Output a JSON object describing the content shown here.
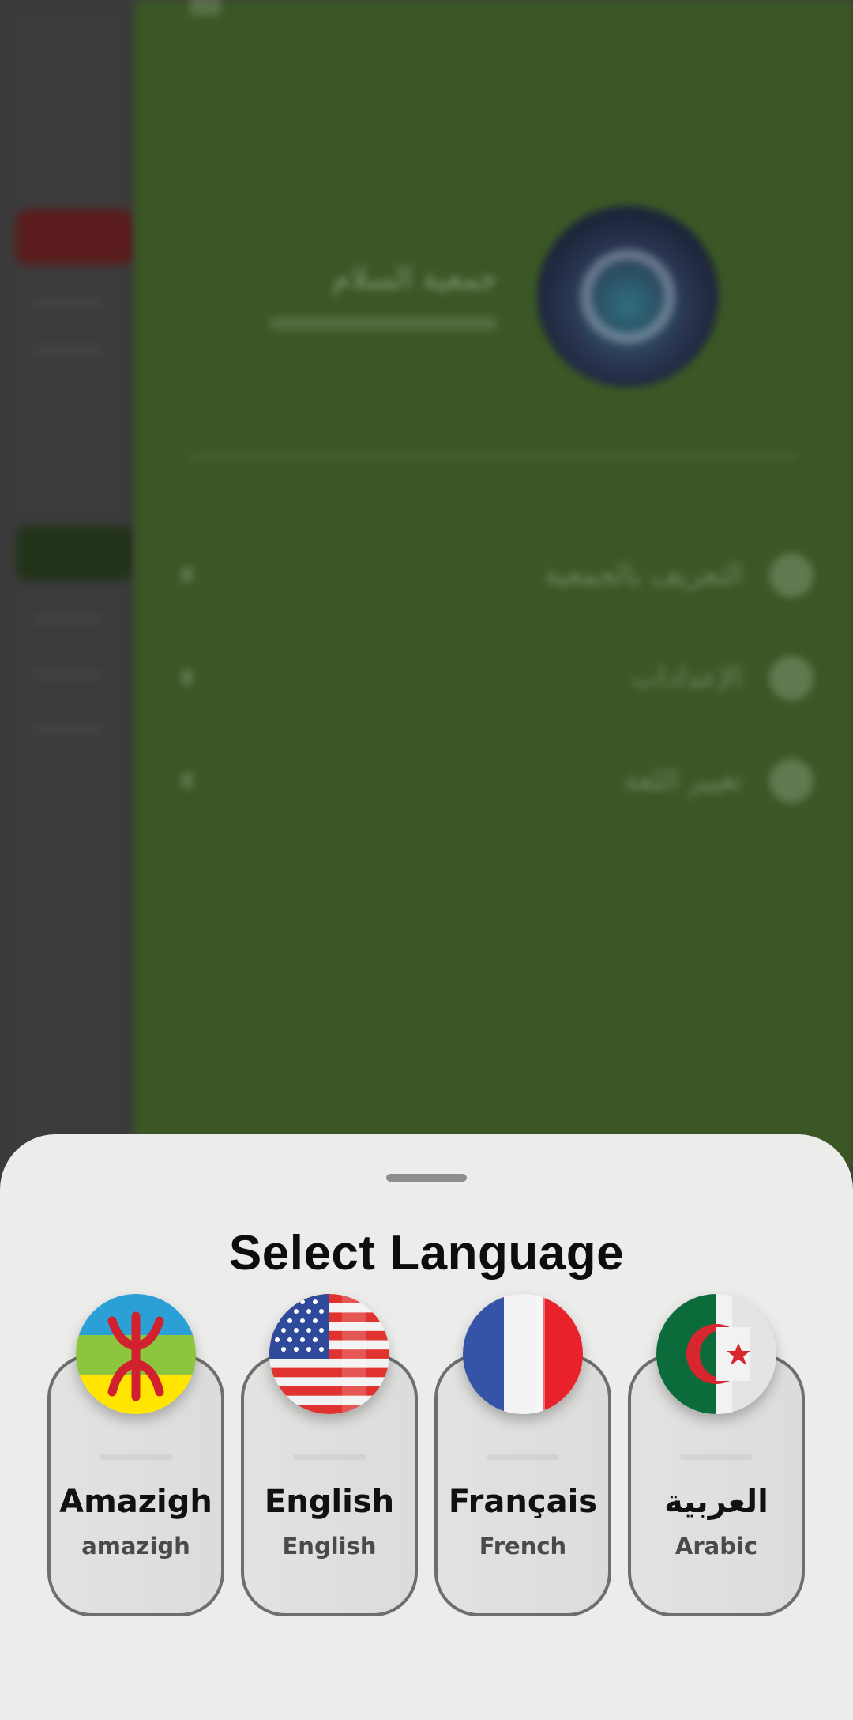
{
  "background_app": {
    "profile_name": "جمعية السلام",
    "menu_items": [
      {
        "label": "التعريف بالجمعية",
        "icon": "info-icon"
      },
      {
        "label": "الإعدادات",
        "icon": "settings-icon"
      },
      {
        "label": "تغيير اللغة",
        "icon": "language-icon"
      }
    ]
  },
  "sheet": {
    "title": "Select Language",
    "languages": [
      {
        "name": "Amazigh",
        "subtitle": "amazigh",
        "flag": "amazigh-flag-icon"
      },
      {
        "name": "English",
        "subtitle": "English",
        "flag": "us-flag-icon"
      },
      {
        "name": "Français",
        "subtitle": "French",
        "flag": "france-flag-icon"
      },
      {
        "name": "العربية",
        "subtitle": "Arabic",
        "flag": "algeria-flag-icon"
      }
    ]
  },
  "colors": {
    "drawer_bg": "#3b5725",
    "scrim_bg": "#3b3b3b",
    "sheet_bg": "#ececea",
    "card_border": "#6e6e6e"
  }
}
